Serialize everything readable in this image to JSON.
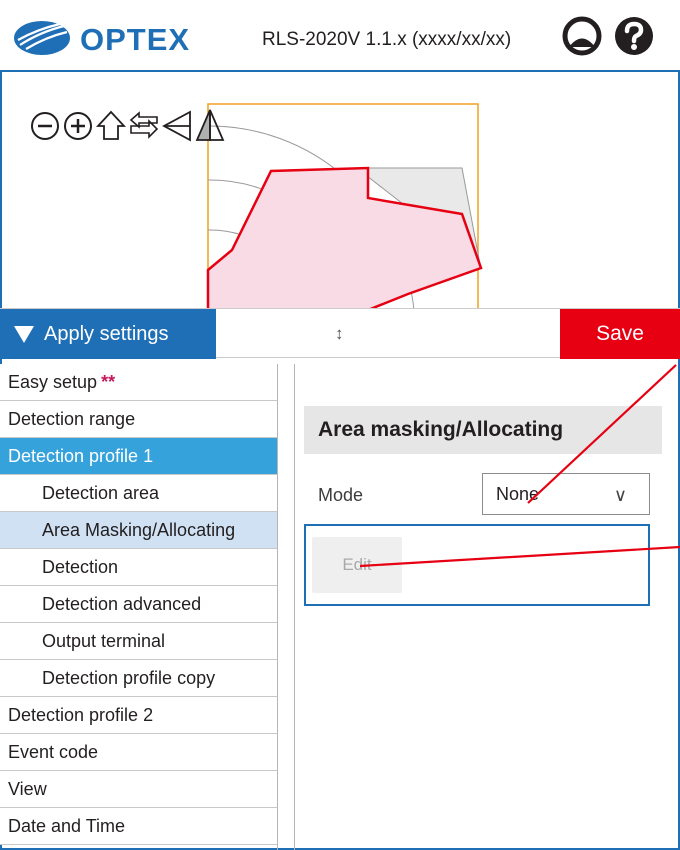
{
  "header": {
    "logo_text": "OPTEX",
    "version": "RLS-2020V 1.1.x (xxxx/xx/xx)",
    "user_icon": "user-circle-icon",
    "help_icon": "question-circle-icon"
  },
  "map": {
    "tools": [
      "zoom-out-icon",
      "zoom-in-icon",
      "home-icon",
      "swap-arrows-icon",
      "flip-triangle-icon",
      "mirror-triangle-icon"
    ]
  },
  "actions": {
    "apply_label": "Apply settings",
    "resize_glyph": "↕",
    "save_label": "Save"
  },
  "sidebar": {
    "items": [
      {
        "label": "Easy setup",
        "stars": "**"
      },
      {
        "label": "Detection range"
      },
      {
        "label": "Detection profile 1"
      },
      {
        "label": "Detection area"
      },
      {
        "label": "Area Masking/Allocating"
      },
      {
        "label": "Detection"
      },
      {
        "label": "Detection advanced"
      },
      {
        "label": "Output terminal"
      },
      {
        "label": "Detection profile copy"
      },
      {
        "label": "Detection profile 2"
      },
      {
        "label": "Event code"
      },
      {
        "label": "View"
      },
      {
        "label": "Date and Time"
      }
    ]
  },
  "panel": {
    "title": "Area masking/Allocating",
    "mode_label": "Mode",
    "mode_value": "None",
    "mode_chevron": "∨",
    "edit_label": "Edit"
  },
  "colors": {
    "brand_blue": "#1f6fb7",
    "active_blue": "#36a2dc",
    "save_red": "#e60012",
    "mask_fill": "#f8dbe5",
    "mask_stroke": "#e60012"
  }
}
